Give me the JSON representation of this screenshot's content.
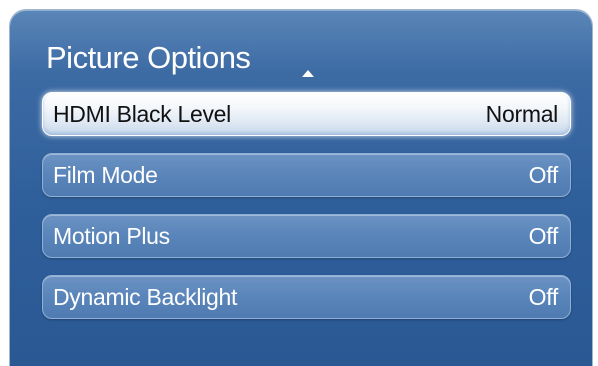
{
  "panel": {
    "title": "Picture Options",
    "scroll_up_icon": "triangle-up-icon"
  },
  "menu": {
    "items": [
      {
        "label": "HDMI Black Level",
        "value": "Normal",
        "selected": true
      },
      {
        "label": "Film Mode",
        "value": "Off",
        "selected": false
      },
      {
        "label": "Motion Plus",
        "value": "Off",
        "selected": false
      },
      {
        "label": "Dynamic Backlight",
        "value": "Off",
        "selected": false
      }
    ]
  },
  "colors": {
    "panel_background": "#3c6aa3",
    "item_background": "#5b86bb",
    "selected_background": "#f4f7fb",
    "text_light": "#ffffff",
    "text_dark": "#111111"
  }
}
